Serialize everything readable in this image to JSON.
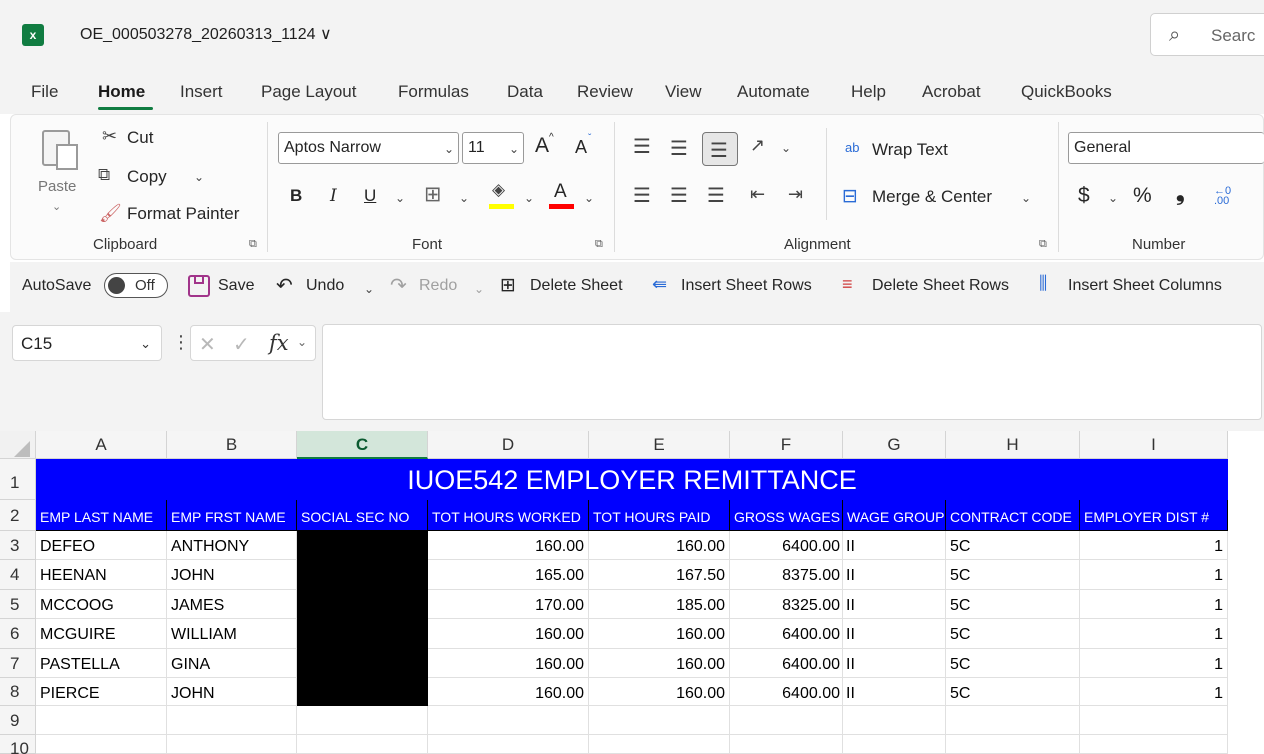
{
  "titlebar": {
    "app_icon": "excel-icon",
    "app_icon_glyph": "x",
    "filename": "OE_000503278_20260313_1124 ∨",
    "search_label": "Searc",
    "search_icon": "⌕"
  },
  "menu": {
    "items": [
      "File",
      "Home",
      "Insert",
      "Page Layout",
      "Formulas",
      "Data",
      "Review",
      "View",
      "Automate",
      "Help",
      "Acrobat",
      "QuickBooks"
    ],
    "active": "Home"
  },
  "ribbon": {
    "clipboard": {
      "paste": "Paste",
      "cut": "Cut",
      "copy": "Copy",
      "format_painter": "Format Painter",
      "group_label": "Clipboard"
    },
    "font": {
      "font_name": "Aptos Narrow",
      "font_size": "11",
      "bold": "B",
      "italic": "I",
      "underline": "U",
      "grow": "A",
      "shrink": "A",
      "font_color": "A",
      "group_label": "Font"
    },
    "alignment": {
      "wrap_text": "Wrap Text",
      "merge_center": "Merge & Center",
      "group_label": "Alignment",
      "wrap_glyph": "ab"
    },
    "number": {
      "format": "General",
      "currency": "$",
      "percent": "%",
      "comma": "❟",
      "group_label": "Number",
      "increase_decimal": "←0 .00"
    }
  },
  "qat": {
    "autosave_label": "AutoSave",
    "autosave_state": "Off",
    "save": "Save",
    "undo": "Undo",
    "redo": "Redo",
    "delete_sheet": "Delete Sheet",
    "insert_rows": "Insert Sheet Rows",
    "delete_rows": "Delete Sheet Rows",
    "insert_columns": "Insert Sheet Columns"
  },
  "formula_bar": {
    "name_box": "C15",
    "fx": "fx",
    "cancel": "✕",
    "enter": "✓",
    "value": ""
  },
  "sheet": {
    "columns": [
      "A",
      "B",
      "C",
      "D",
      "E",
      "F",
      "G",
      "H",
      "I"
    ],
    "selected_column": "C",
    "rows": [
      "1",
      "2",
      "3",
      "4",
      "5",
      "6",
      "7",
      "8",
      "9",
      "10"
    ],
    "title": "IUOE542 EMPLOYER REMITTANCE",
    "headers": [
      "EMP LAST NAME",
      "EMP FRST NAME",
      "SOCIAL SEC NO",
      "TOT HOURS WORKED",
      "TOT HOURS PAID",
      "GROSS WAGES",
      "WAGE GROUP",
      "CONTRACT CODE",
      "EMPLOYER DIST #"
    ],
    "data": [
      [
        "DEFEO",
        "ANTHONY",
        "",
        "160.00",
        "160.00",
        "6400.00",
        "II",
        "5C",
        "1"
      ],
      [
        "HEENAN",
        "JOHN",
        "",
        "165.00",
        "167.50",
        "8375.00",
        "II",
        "5C",
        "1"
      ],
      [
        "MCCOOG",
        "JAMES",
        "",
        "170.00",
        "185.00",
        "8325.00",
        "II",
        "5C",
        "1"
      ],
      [
        "MCGUIRE",
        "WILLIAM",
        "",
        "160.00",
        "160.00",
        "6400.00",
        "II",
        "5C",
        "1"
      ],
      [
        "PASTELLA",
        "GINA",
        "",
        "160.00",
        "160.00",
        "6400.00",
        "II",
        "5C",
        "1"
      ],
      [
        "PIERCE",
        "JOHN",
        "",
        "160.00",
        "160.00",
        "6400.00",
        "II",
        "5C",
        "1"
      ]
    ],
    "colors": {
      "header_fill": "#0000ff",
      "header_text": "#ffffff",
      "redaction": "#000000",
      "accent": "#107c41"
    }
  }
}
